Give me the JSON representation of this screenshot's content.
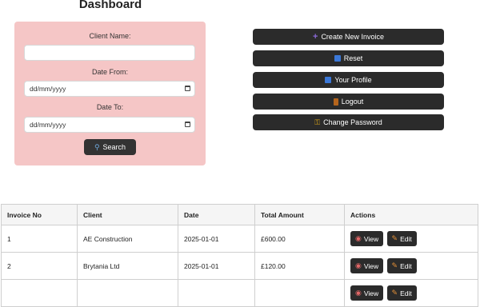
{
  "page": {
    "title": "Dashboard"
  },
  "filters": {
    "client_label": "Client Name:",
    "client_value": "",
    "date_from_label": "Date From:",
    "date_from_placeholder": "dd/mm/yyyy",
    "date_to_label": "Date To:",
    "date_to_placeholder": "dd/mm/yyyy",
    "search_label": "Search",
    "search_icon": "magnifier-icon"
  },
  "actions": [
    {
      "label": "Create New Invoice",
      "icon": "plus-icon"
    },
    {
      "label": "Reset",
      "icon": "reset-icon"
    },
    {
      "label": "Your Profile",
      "icon": "profile-icon"
    },
    {
      "label": "Logout",
      "icon": "door-icon"
    },
    {
      "label": "Change Password",
      "icon": "key-icon"
    }
  ],
  "table": {
    "headers": [
      "Invoice No",
      "Client",
      "Date",
      "Total Amount",
      "Actions"
    ],
    "rows": [
      {
        "no": "1",
        "client": "AE Construction",
        "date": "2025-01-01",
        "total": "£600.00",
        "view": "View",
        "edit": "Edit"
      },
      {
        "no": "2",
        "client": "Brytania Ltd",
        "date": "2025-01-01",
        "total": "£120.00",
        "view": "View",
        "edit": "Edit"
      },
      {
        "no": "",
        "client": "",
        "date": "",
        "total": "",
        "view": "View",
        "edit": "Edit"
      }
    ]
  },
  "colors": {
    "panel_bg": "#f5c6c6",
    "button_bg": "#2b2b2b",
    "plus_icon": "#8a6ad8",
    "reset_icon": "#3b78d8",
    "profile_icon": "#3b78d8",
    "door_icon": "#b5651d",
    "key_icon": "#d4a017"
  }
}
